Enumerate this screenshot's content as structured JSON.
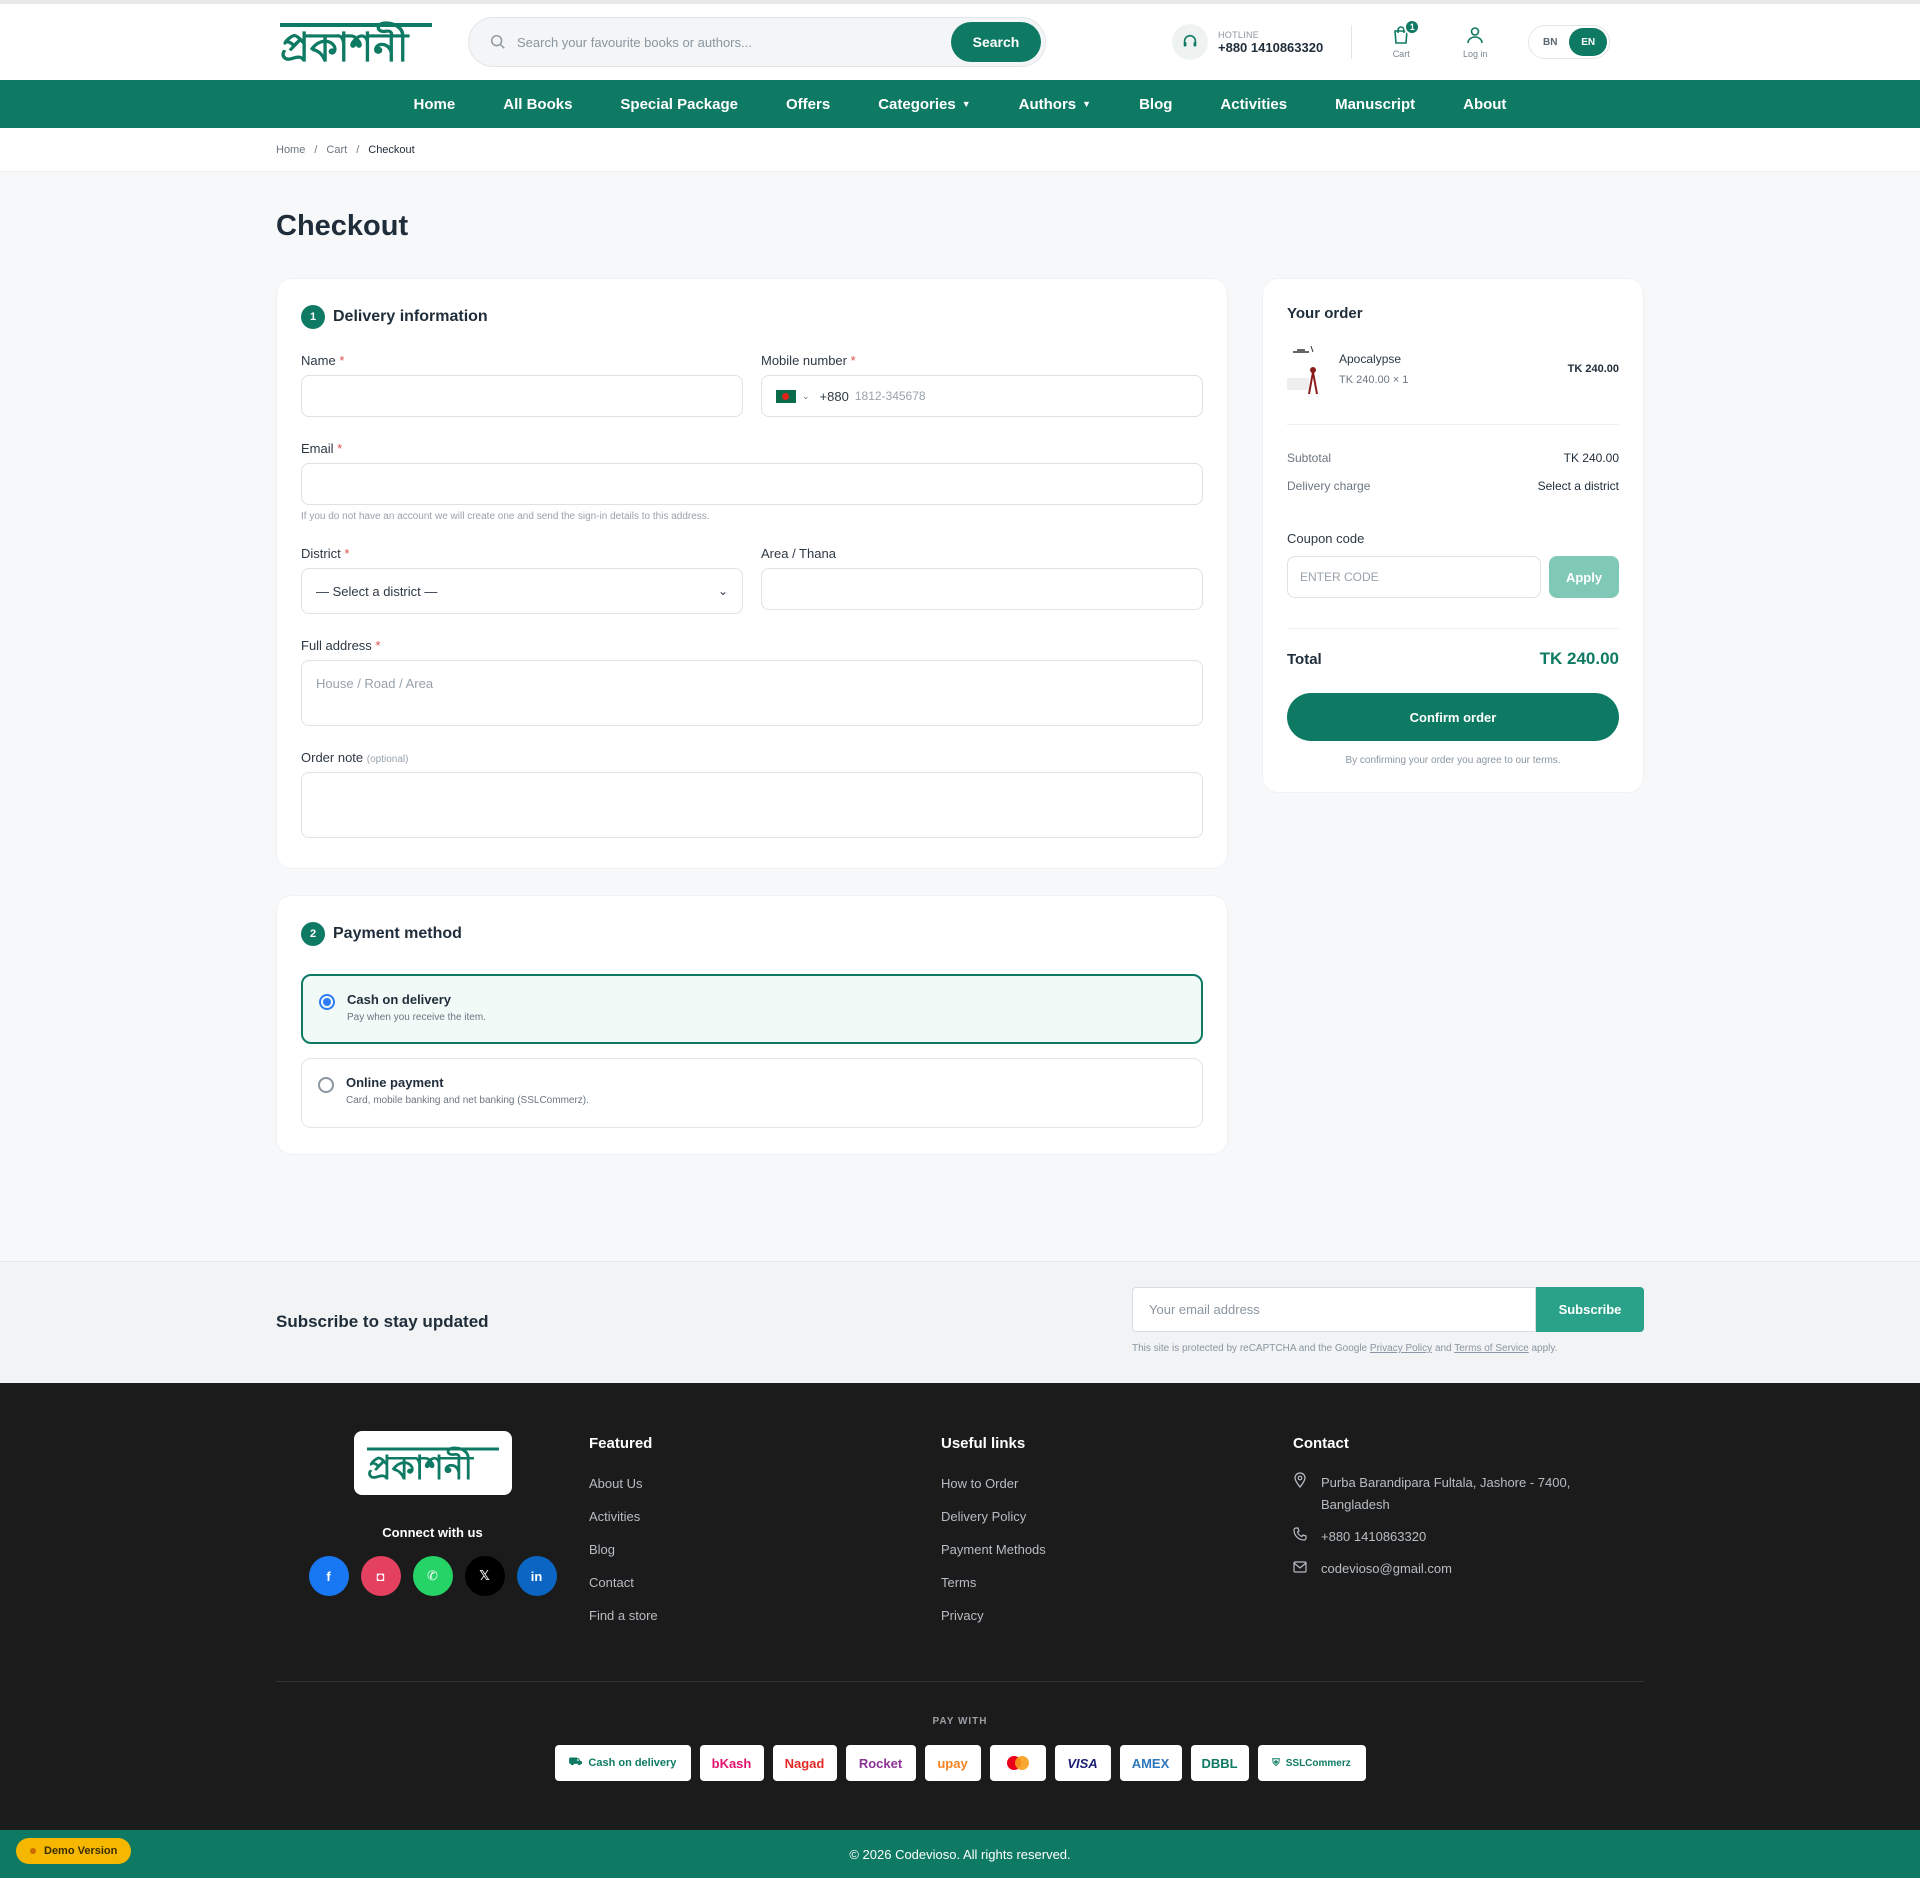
{
  "header": {
    "logo_text": "প্রকাশনী",
    "search": {
      "placeholder": "Search your favourite books or authors...",
      "button": "Search"
    },
    "hotline": {
      "label": "HOTLINE",
      "number": "+880 1410863320"
    },
    "cart": {
      "label": "Cart",
      "count": "1"
    },
    "login": {
      "label": "Log in"
    },
    "lang": {
      "bn": "BN",
      "en": "EN",
      "active": "EN"
    }
  },
  "nav": [
    {
      "label": "Home"
    },
    {
      "label": "All Books"
    },
    {
      "label": "Special Package"
    },
    {
      "label": "Offers"
    },
    {
      "label": "Categories",
      "dropdown": true
    },
    {
      "label": "Authors",
      "dropdown": true
    },
    {
      "label": "Blog"
    },
    {
      "label": "Activities"
    },
    {
      "label": "Manuscript"
    },
    {
      "label": "About"
    }
  ],
  "breadcrumb": {
    "home": "Home",
    "cart": "Cart",
    "current": "Checkout",
    "sep": "/"
  },
  "page_title": "Checkout",
  "delivery": {
    "step": "1",
    "title": "Delivery information",
    "name_label": "Name",
    "mobile_label": "Mobile number",
    "mobile_code": "+880",
    "mobile_placeholder": "1812-345678",
    "email_label": "Email",
    "email_hint": "If you do not have an account we will create one and send the sign-in details to this address.",
    "district_label": "District",
    "district_value": "— Select a district —",
    "area_label": "Area / Thana",
    "address_label": "Full address",
    "address_placeholder": "House / Road / Area",
    "note_label": "Order note",
    "note_optional": "(optional)",
    "required_mark": "*"
  },
  "payment": {
    "step": "2",
    "title": "Payment method",
    "options": [
      {
        "title": "Cash on delivery",
        "desc": "Pay when you receive the item.",
        "selected": true
      },
      {
        "title": "Online payment",
        "desc": "Card, mobile banking and net banking (SSLCommerz).",
        "selected": false
      }
    ]
  },
  "order": {
    "title": "Your order",
    "item": {
      "name": "Apocalypse",
      "price_qty": "TK 240.00 × 1",
      "total": "TK 240.00"
    },
    "subtotal_label": "Subtotal",
    "subtotal_value": "TK 240.00",
    "delivery_label": "Delivery charge",
    "delivery_value": "Select a district",
    "coupon_label": "Coupon code",
    "coupon_placeholder": "ENTER CODE",
    "coupon_button": "Apply",
    "total_label": "Total",
    "total_value": "TK 240.00",
    "confirm_button": "Confirm order",
    "terms": "By confirming your order you agree to our terms."
  },
  "subscribe": {
    "title": "Subscribe to stay updated",
    "placeholder": "Your email address",
    "button": "Subscribe",
    "recaptcha_pre": "This site is protected by reCAPTCHA and the Google",
    "privacy": "Privacy Policy",
    "and": "and",
    "tos": "Terms of Service",
    "apply": "apply."
  },
  "footer": {
    "connect": "Connect with us",
    "socials": [
      {
        "name": "facebook",
        "glyph": "f",
        "color": "#1877f2"
      },
      {
        "name": "instagram",
        "glyph": "◘",
        "color": "#e4405f"
      },
      {
        "name": "whatsapp",
        "glyph": "✆",
        "color": "#25d366"
      },
      {
        "name": "x",
        "glyph": "𝕏",
        "color": "#000000"
      },
      {
        "name": "linkedin",
        "glyph": "in",
        "color": "#0a66c2"
      }
    ],
    "featured": {
      "title": "Featured",
      "links": [
        "About Us",
        "Activities",
        "Blog",
        "Contact",
        "Find a store"
      ]
    },
    "useful": {
      "title": "Useful links",
      "links": [
        "How to Order",
        "Delivery Policy",
        "Payment Methods",
        "Terms",
        "Privacy"
      ]
    },
    "contact": {
      "title": "Contact",
      "address": "Purba Barandipara Fultala, Jashore - 7400, Bangladesh",
      "phone": "+880 1410863320",
      "email": "codevioso@gmail.com"
    },
    "pay_with": "PAY WITH",
    "pay_methods": [
      {
        "label": "Cash on delivery",
        "color": "#0e7a63"
      },
      {
        "label": "bKash",
        "color": "#e2136e"
      },
      {
        "label": "Nagad",
        "color": "#e42a26"
      },
      {
        "label": "Rocket",
        "color": "#8c3494"
      },
      {
        "label": "upay",
        "color": "#f58220"
      },
      {
        "label": "",
        "color": "#eb001b",
        "icon": "mastercard"
      },
      {
        "label": "VISA",
        "color": "#1a1f71"
      },
      {
        "label": "AMEX",
        "color": "#2e77bc"
      },
      {
        "label": "DBBL",
        "color": "#0e7a63"
      },
      {
        "label": "SSLCommerz",
        "color": "#0e7a63"
      }
    ],
    "copyright": "© 2026 Codevioso. All rights reserved.",
    "demo": "Demo Version"
  },
  "colors": {
    "brand": "#0e7a63",
    "footer_bg": "#1b1b1c"
  }
}
